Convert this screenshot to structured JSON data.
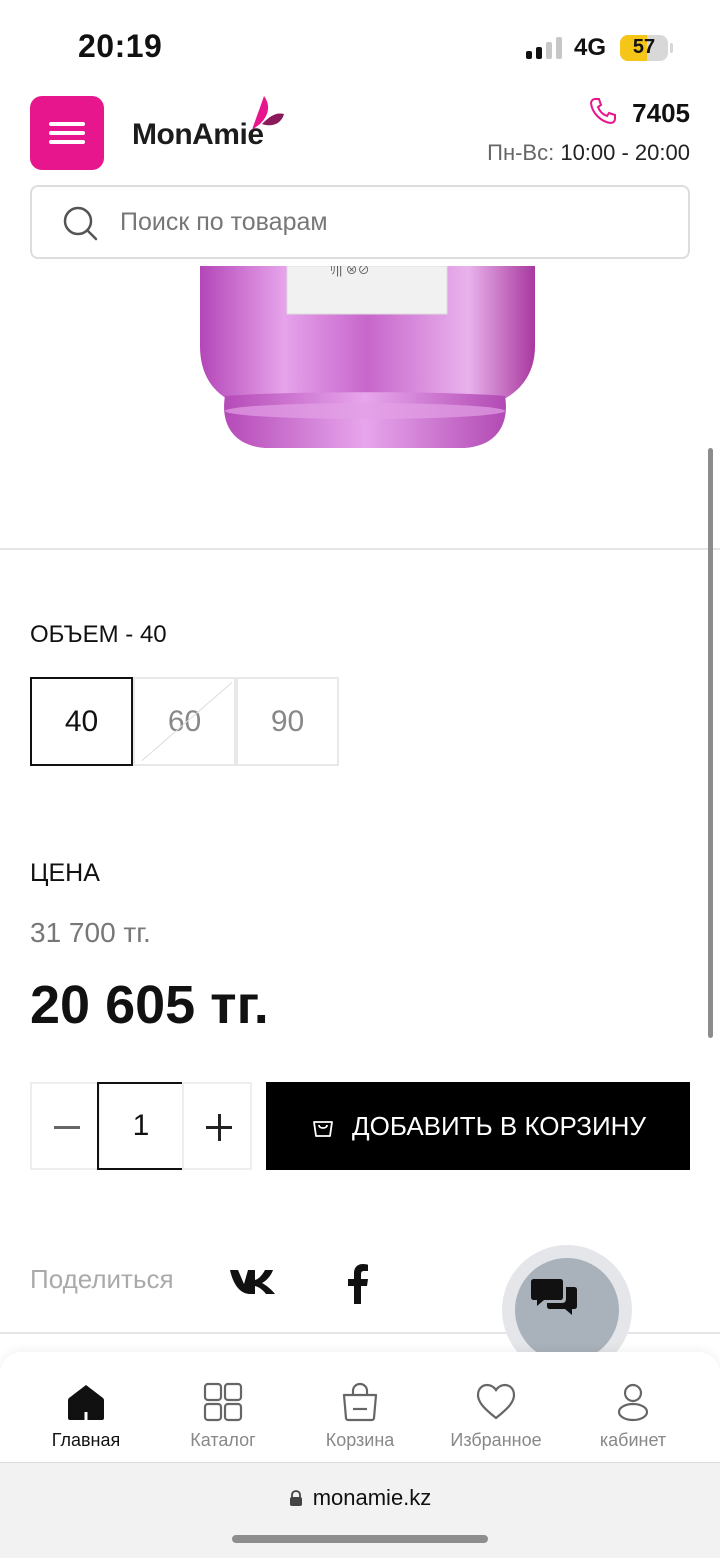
{
  "status_bar": {
    "time": "20:19",
    "network": "4G",
    "battery": "57"
  },
  "header": {
    "logo": "MonAmie",
    "phone": "7405",
    "hours_label": "Пн-Вс:",
    "hours": "10:00 - 20:00"
  },
  "search": {
    "placeholder": "Поиск по товарам"
  },
  "volume": {
    "label": "ОБЪЕМ - 40",
    "options": [
      "40",
      "60",
      "90"
    ],
    "selected": "40",
    "unavailable": [
      "60"
    ]
  },
  "price": {
    "label": "ЦЕНА",
    "old": "31 700 тг.",
    "current": "20 605 тг."
  },
  "quantity": {
    "value": "1"
  },
  "cart_button": {
    "label": "ДОБАВИТЬ В КОРЗИНУ"
  },
  "share": {
    "label": "Поделиться"
  },
  "bottom_nav": {
    "items": [
      {
        "label": "Главная",
        "icon": "home-icon",
        "active": true
      },
      {
        "label": "Каталог",
        "icon": "grid-icon"
      },
      {
        "label": "Корзина",
        "icon": "bag-icon"
      },
      {
        "label": "Избранное",
        "icon": "heart-icon"
      },
      {
        "label": "кабинет",
        "icon": "user-icon"
      }
    ]
  },
  "browser": {
    "url": "monamie.kz"
  },
  "colors": {
    "brand": "#e8168c",
    "button": "#000000",
    "chat": "#a9b1ba"
  }
}
